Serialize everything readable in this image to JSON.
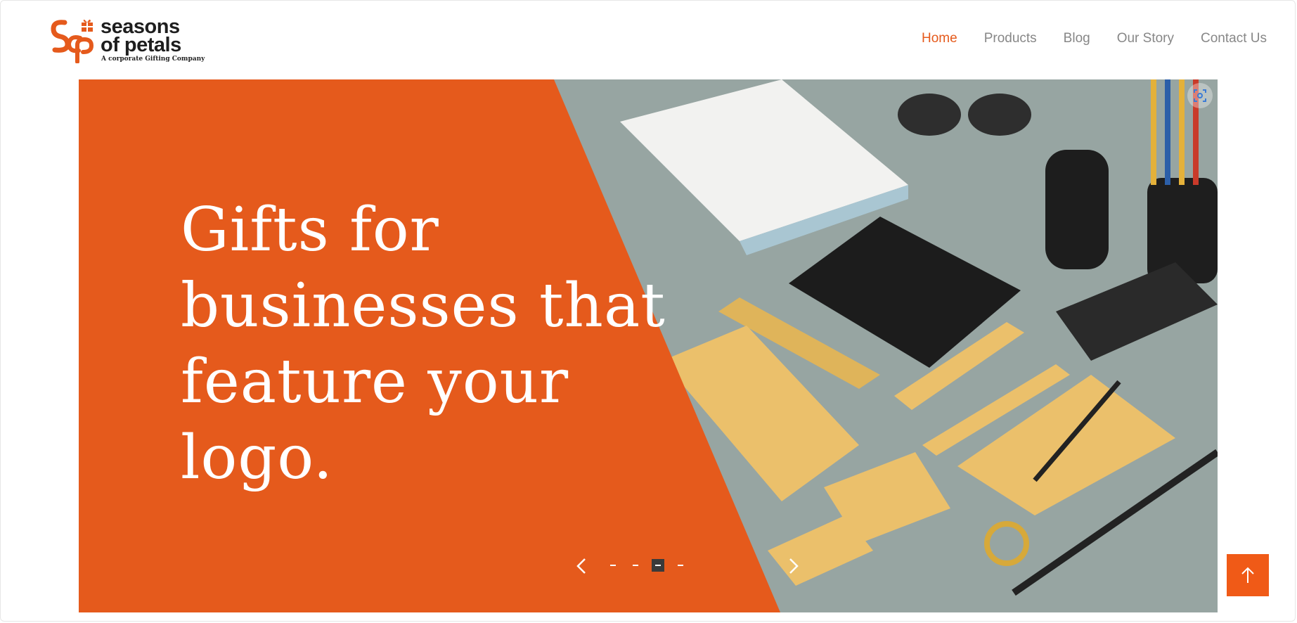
{
  "brand": {
    "line1": "seasons",
    "line2": "of petals",
    "tagline": "A corporate Gifting Company",
    "logo_icon": "sop-monogram-gift-icon",
    "accent_color": "#e55a1c"
  },
  "nav": {
    "items": [
      {
        "label": "Home",
        "active": true
      },
      {
        "label": "Products",
        "active": false
      },
      {
        "label": "Blog",
        "active": false
      },
      {
        "label": "Our Story",
        "active": false
      },
      {
        "label": "Contact Us",
        "active": false
      }
    ],
    "active_color": "#e55a1c",
    "inactive_color": "#878787"
  },
  "hero": {
    "title": "Gifts for businesses that feature your logo.",
    "panel_color": "#e55a1c",
    "image_subject": "office-stationery-flatlay",
    "slider": {
      "prev_icon": "chevron-left-icon",
      "next_icon": "chevron-right-icon",
      "slide_count": 4,
      "active_slide": 3
    },
    "lens_icon": "visual-search-icon"
  },
  "scroll_top": {
    "icon": "arrow-up-icon",
    "color": "#f05a17"
  }
}
